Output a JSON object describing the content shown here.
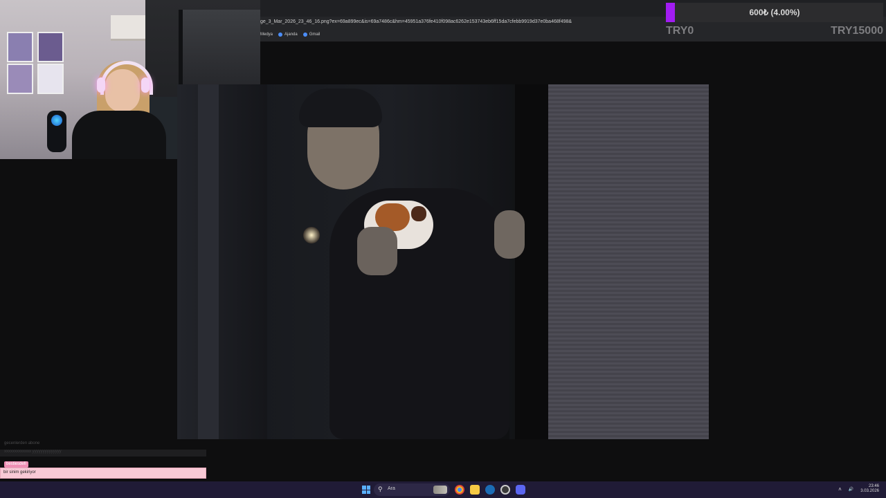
{
  "browser": {
    "url": "ge_3_Mar_2026_23_46_16.png?ex=69a899ec&is=69a7486c&hm=45951a376fe410f098ac6262e153743eb6ff15da7cfebb9919d37e0ba468f498&",
    "bookmarks": [
      {
        "label": "Medya",
        "icon": "folder-icon"
      },
      {
        "label": "Ajanda",
        "icon": "globe-icon"
      },
      {
        "label": "Gmail",
        "icon": "globe-icon"
      }
    ]
  },
  "goal": {
    "text": "600₺ (4.00%)",
    "percent": 4,
    "min_label": "TRY0",
    "max_label": "TRY15000",
    "fill_color": "#a21cf2"
  },
  "chat": {
    "ghost_1": "gecenlerden abone",
    "ghost_2": "xxxxxxxxxxxxx yyyyyyyyyyyyyy",
    "username": "bestiesdefi",
    "message": "bir sinim gekiriyor"
  },
  "taskbar": {
    "search_placeholder": "Ara",
    "clock_time": "23:46",
    "clock_date": "3.03.2026"
  }
}
